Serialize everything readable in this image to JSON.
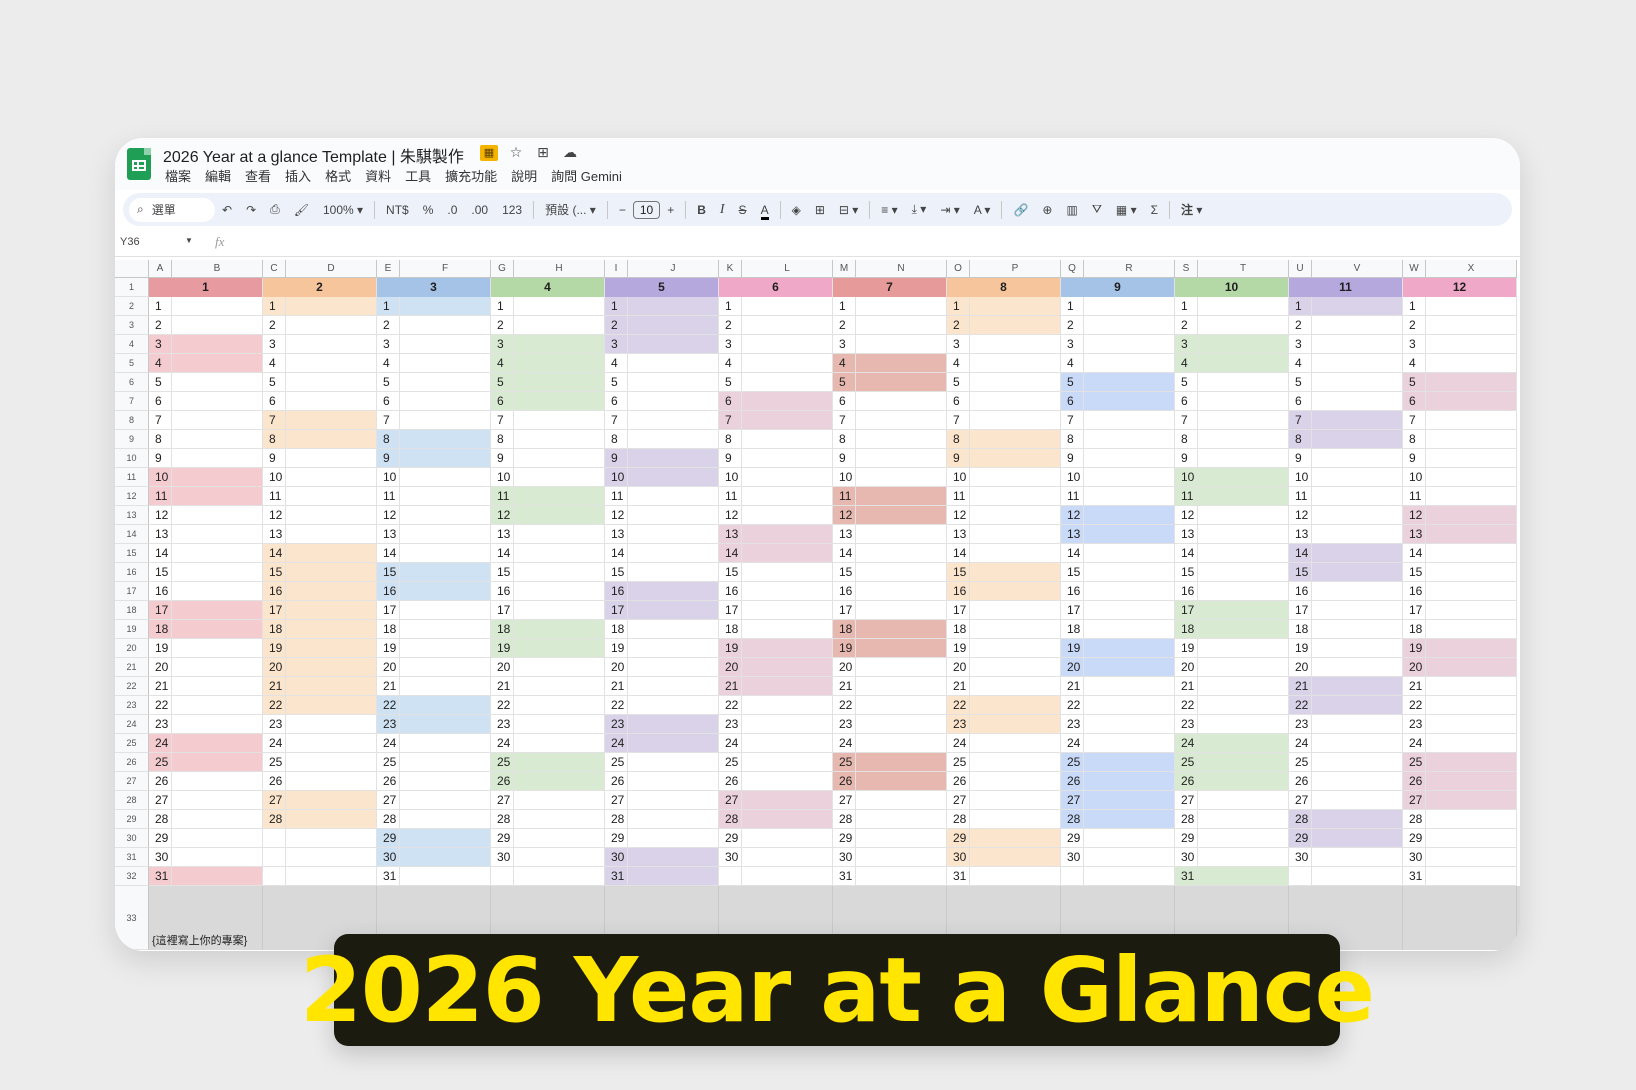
{
  "app": {
    "title": "2026 Year at a glance Template | 朱騏製作",
    "title_icons": [
      "template-badge-icon",
      "star-icon",
      "move-to-folder-icon",
      "cloud-status-icon"
    ],
    "menu": [
      "檔案",
      "編輯",
      "查看",
      "插入",
      "格式",
      "資料",
      "工具",
      "擴充功能",
      "說明",
      "詢問 Gemini"
    ]
  },
  "toolbar": {
    "search_label": "選單",
    "zoom": "100%",
    "currency": "NT$",
    "percent": "%",
    "dec_decrease": ".0",
    "dec_increase": ".00",
    "number_format": "123",
    "font": "預設 (...",
    "font_size": "10"
  },
  "formula_bar": {
    "cell_ref": "Y36",
    "fx": "fx"
  },
  "columns": [
    "A",
    "B",
    "C",
    "D",
    "E",
    "F",
    "G",
    "H",
    "I",
    "J",
    "K",
    "L",
    "M",
    "N",
    "O",
    "P",
    "Q",
    "R",
    "S",
    "T",
    "U",
    "V",
    "W",
    "X"
  ],
  "row_numbers": [
    "1",
    "2",
    "3",
    "4",
    "5",
    "6",
    "7",
    "8",
    "9",
    "10",
    "11",
    "12",
    "13",
    "14",
    "15",
    "16",
    "17",
    "18",
    "19",
    "20",
    "21",
    "22",
    "23",
    "24",
    "25",
    "26",
    "27",
    "28",
    "29",
    "30",
    "31",
    "32",
    "33"
  ],
  "months": [
    {
      "label": "1",
      "color": "#e79aa0",
      "light": "#f4cccf",
      "days": 31,
      "highlight": [
        3,
        4,
        10,
        11,
        17,
        18,
        24,
        25,
        31
      ]
    },
    {
      "label": "2",
      "color": "#f7c59c",
      "light": "#fce5cd",
      "days": 28,
      "highlight": [
        1,
        7,
        8,
        14,
        15,
        16,
        17,
        18,
        19,
        20,
        21,
        22,
        27,
        28
      ]
    },
    {
      "label": "3",
      "color": "#a5c3e6",
      "light": "#cfe2f3",
      "days": 31,
      "highlight": [
        1,
        8,
        9,
        15,
        16,
        22,
        23,
        29,
        30
      ]
    },
    {
      "label": "4",
      "color": "#b4d8a6",
      "light": "#d9ead3",
      "days": 30,
      "highlight": [
        3,
        4,
        5,
        6,
        11,
        12,
        18,
        19,
        25,
        26
      ]
    },
    {
      "label": "5",
      "color": "#b4a8dc",
      "light": "#d9d2e9",
      "days": 31,
      "highlight": [
        1,
        2,
        3,
        9,
        10,
        16,
        17,
        23,
        24,
        30,
        31
      ]
    },
    {
      "label": "6",
      "color": "#f0a8c8",
      "light": "#ead1dc",
      "days": 30,
      "highlight": [
        6,
        7,
        13,
        14,
        19,
        20,
        21,
        27,
        28
      ]
    },
    {
      "label": "7",
      "color": "#e79a9a",
      "light": "#e6b8af",
      "days": 31,
      "highlight": [
        4,
        5,
        11,
        12,
        18,
        19,
        25,
        26
      ]
    },
    {
      "label": "8",
      "color": "#f7c59c",
      "light": "#fce5cd",
      "days": 31,
      "highlight": [
        1,
        2,
        8,
        9,
        15,
        16,
        22,
        23,
        29,
        30
      ]
    },
    {
      "label": "9",
      "color": "#a5c3e6",
      "light": "#c9daf8",
      "days": 30,
      "highlight": [
        5,
        6,
        12,
        13,
        19,
        20,
        25,
        26,
        27,
        28
      ]
    },
    {
      "label": "10",
      "color": "#b4d8a6",
      "light": "#d9ead3",
      "days": 31,
      "highlight": [
        3,
        4,
        10,
        11,
        17,
        18,
        24,
        25,
        26,
        31
      ]
    },
    {
      "label": "11",
      "color": "#b4a8dc",
      "light": "#d9d2e9",
      "days": 30,
      "highlight": [
        1,
        7,
        8,
        14,
        15,
        21,
        22,
        28,
        29
      ]
    },
    {
      "label": "12",
      "color": "#f0a8c8",
      "light": "#ead1dc",
      "days": 31,
      "highlight": [
        5,
        6,
        12,
        13,
        19,
        20,
        25,
        26,
        27
      ]
    }
  ],
  "project_note": "{這裡寫上你的專案}",
  "banner": "2026 Year at a Glance"
}
